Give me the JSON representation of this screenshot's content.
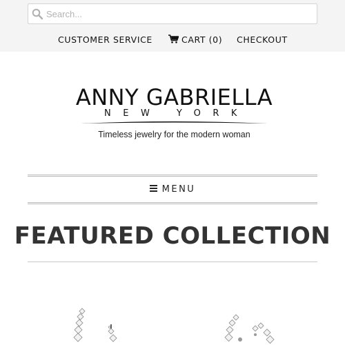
{
  "search": {
    "placeholder": "Search...",
    "value": ""
  },
  "top_nav": {
    "customer_service": "CUSTOMER SERVICE",
    "cart_label": "CART",
    "cart_count": "(0)",
    "checkout": "CHECKOUT"
  },
  "logo": {
    "brand": "ANNY GABRIELLA",
    "city": "NEW YORK",
    "tagline": "Timeless jewelry for the modern woman"
  },
  "menu": {
    "label": "MENU"
  },
  "section": {
    "title": "FEATURED COLLECTION"
  },
  "icons": {
    "search": "search-icon",
    "cart": "cart-icon",
    "menu": "hamburger-icon"
  },
  "colors": {
    "topbar_bg": "#f4f4f4",
    "text": "#111111",
    "rule": "#b8b8b8"
  }
}
